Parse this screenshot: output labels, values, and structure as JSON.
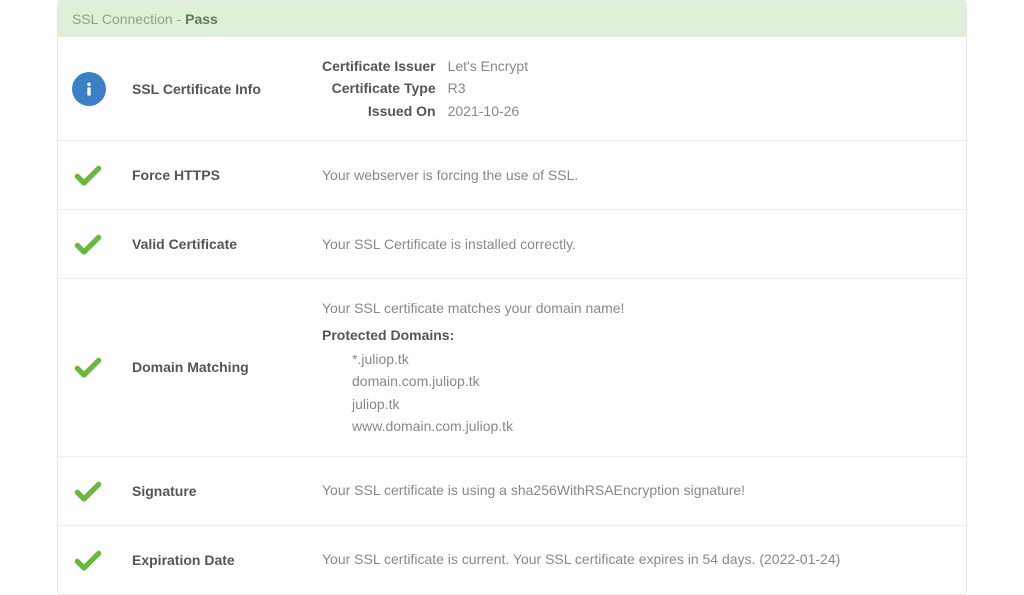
{
  "header": {
    "title": "SSL Connection - ",
    "status": "Pass"
  },
  "colors": {
    "headerBg": "#dff0d8",
    "infoIconBg": "#3b7fc4",
    "checkColor": "#6bb841"
  },
  "rows": {
    "info": {
      "label": "SSL Certificate Info",
      "issuer_key": "Certificate Issuer",
      "issuer_val": "Let's Encrypt",
      "type_key": "Certificate Type",
      "type_val": "R3",
      "issued_key": "Issued On",
      "issued_val": "2021-10-26"
    },
    "force_https": {
      "label": "Force HTTPS",
      "desc": "Your webserver is forcing the use of SSL."
    },
    "valid_cert": {
      "label": "Valid Certificate",
      "desc": "Your SSL Certificate is installed correctly."
    },
    "domain_matching": {
      "label": "Domain Matching",
      "desc": "Your SSL certificate matches your domain name!",
      "protected_label": "Protected Domains:",
      "domains": {
        "d0": "*.juliop.tk",
        "d1": "domain.com.juliop.tk",
        "d2": "juliop.tk",
        "d3": "www.domain.com.juliop.tk"
      }
    },
    "signature": {
      "label": "Signature",
      "desc": "Your SSL certificate is using a sha256WithRSAEncryption signature!"
    },
    "expiration": {
      "label": "Expiration Date",
      "desc": "Your SSL certificate is current. Your SSL certificate expires in 54 days. (2022-01-24)"
    }
  }
}
